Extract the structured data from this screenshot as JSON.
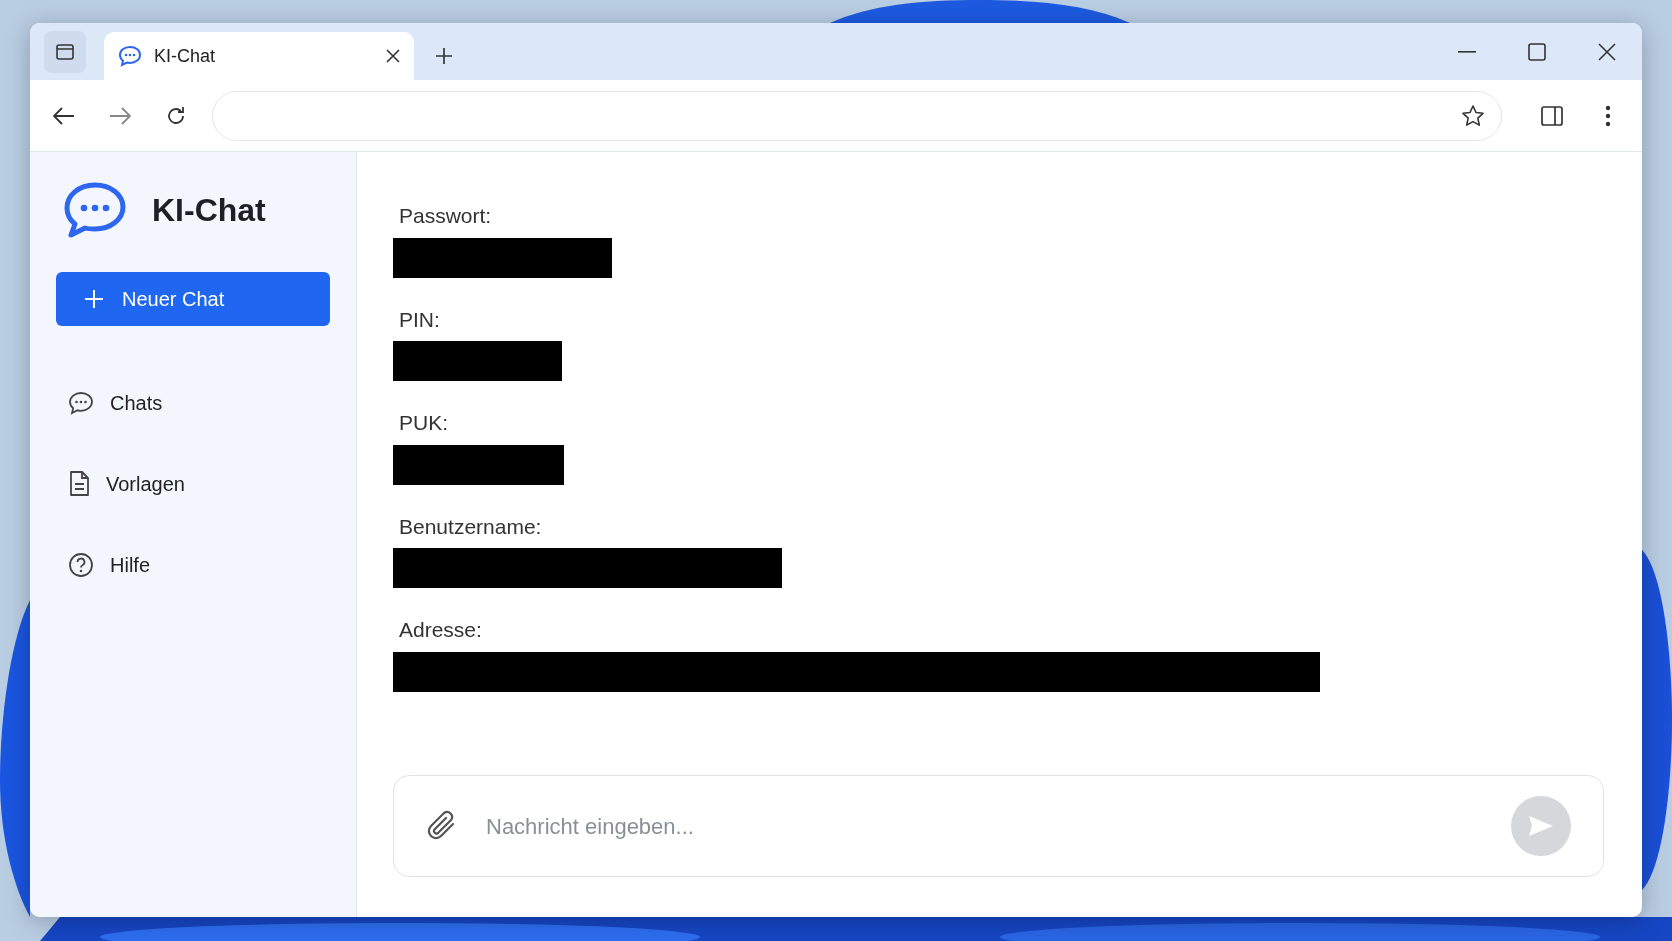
{
  "browser": {
    "tabs": [
      {
        "title": "KI-Chat",
        "selected": true
      }
    ]
  },
  "app": {
    "title": "KI-Chat",
    "new_chat_button": "Neuer Chat",
    "sidebar": {
      "items": [
        {
          "label": "Chats"
        },
        {
          "label": "Vorlagen"
        },
        {
          "label": "Hilfe"
        }
      ]
    },
    "fields": [
      {
        "label": "Passwort:",
        "redacted": true
      },
      {
        "label": "PIN:",
        "redacted": true
      },
      {
        "label": "PUK:",
        "redacted": true
      },
      {
        "label": "Benutzername:",
        "redacted": true
      },
      {
        "label": "Adresse:",
        "redacted": true
      }
    ],
    "composer": {
      "placeholder": "Nachricht eingeben...",
      "send_disabled": true
    }
  }
}
